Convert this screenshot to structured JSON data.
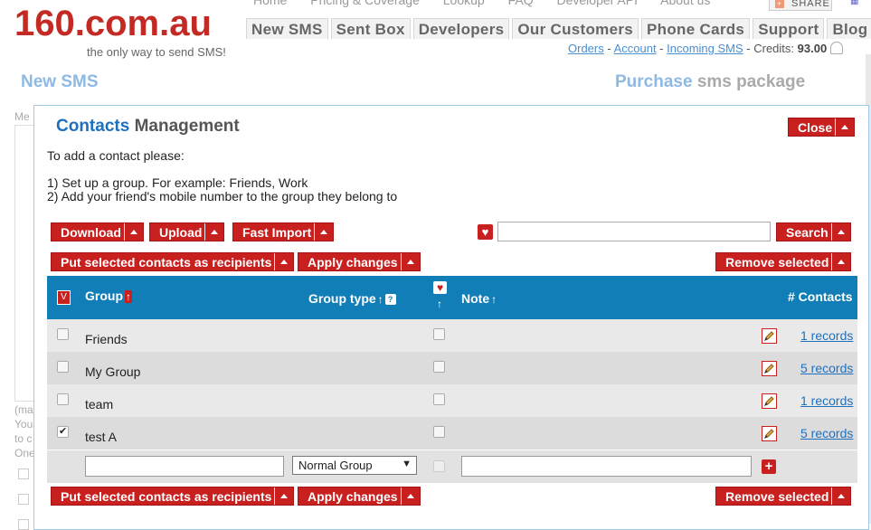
{
  "site": {
    "logo": "160.com.au",
    "tagline": "the only way to send SMS!",
    "topnav_faint": [
      "Home",
      "Pricing & Coverage",
      "Lookup",
      "FAQ",
      "Developer API",
      "About us"
    ],
    "share_label": "SHARE",
    "mainnav": [
      "New SMS",
      "Sent Box",
      "Developers",
      "Our Customers",
      "Phone Cards",
      "Support",
      "Blog"
    ],
    "subnav": {
      "orders": "Orders",
      "sep1": " - ",
      "account": "Account",
      "sep2": " - ",
      "incoming": "Incoming SMS",
      "credits_label": " - Credits: ",
      "credits_value": "93.00"
    },
    "section_left": "New SMS",
    "section_right_a": "Purchase",
    "section_right_b": " sms package",
    "bg_me": "Me",
    "bg_side_text": [
      "(ma",
      "You",
      "to c",
      "One"
    ]
  },
  "modal": {
    "title_a": "Contacts",
    "title_b": " Management",
    "close_label": "Close",
    "intro_1": "To add a contact please:",
    "intro_2": "1) Set up a group. For example: Friends, Work",
    "intro_3": "2) Add your friend's mobile number to the group they belong to",
    "toolbar": {
      "download": "Download",
      "upload": "Upload",
      "fast_import": "Fast Import",
      "search": "Search",
      "search_value": "",
      "put_recipients": "Put selected contacts as recipients",
      "apply_changes": "Apply changes",
      "remove_selected": "Remove selected"
    },
    "table": {
      "select_all": "V",
      "columns": {
        "group": "Group",
        "group_type": "Group type",
        "note": "Note",
        "contacts": "# Contacts"
      },
      "rows": [
        {
          "group": "Friends",
          "checked": false,
          "records": "1 records"
        },
        {
          "group": "My Group",
          "checked": false,
          "records": "5 records"
        },
        {
          "group": "team",
          "checked": false,
          "records": "1 records"
        },
        {
          "group": "test A",
          "checked": true,
          "records": "5 records"
        }
      ],
      "new_row": {
        "group_value": "",
        "type_selected": "Normal Group",
        "note_value": ""
      }
    },
    "colors": {
      "accent_red": "#c81f1f",
      "header_blue": "#127eb8",
      "link_blue": "#1f6fbf"
    }
  }
}
